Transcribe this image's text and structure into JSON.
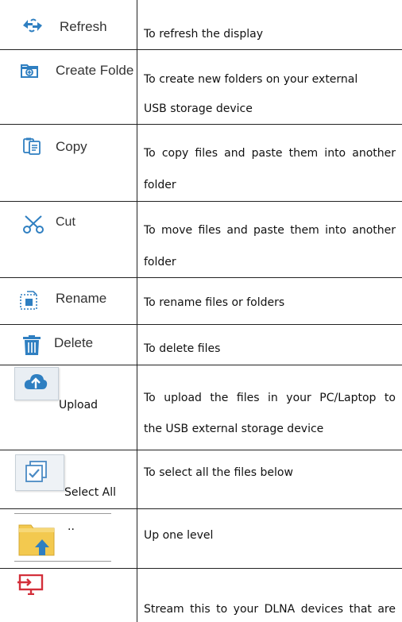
{
  "rows": [
    {
      "label": "Refresh",
      "icon": "refresh-icon",
      "desc": [
        "To refresh the display"
      ]
    },
    {
      "label": "Create Folde",
      "icon": "create-folder-icon",
      "desc": [
        "To create new folders on your external",
        "USB storage device"
      ]
    },
    {
      "label": "Copy",
      "icon": "copy-icon",
      "desc": [
        "To copy files and paste them into another",
        "folder"
      ]
    },
    {
      "label": "Cut",
      "icon": "scissors-icon",
      "desc": [
        "To move files and paste them into another",
        "folder"
      ]
    },
    {
      "label": "Rename",
      "icon": "rename-icon",
      "desc": [
        "To rename files or folders"
      ]
    },
    {
      "label": "Delete",
      "icon": "trash-icon",
      "desc": [
        "To delete files"
      ]
    },
    {
      "label": "Upload",
      "icon": "cloud-upload-icon",
      "desc": [
        "To upload the files in your PC/Laptop to",
        "the USB external storage device"
      ]
    },
    {
      "label": "Select All",
      "icon": "select-all-icon",
      "desc": [
        "To select all the files below"
      ]
    },
    {
      "label": "..",
      "icon": "folder-up-icon",
      "desc": [
        "Up one level"
      ]
    },
    {
      "label": "",
      "icon": "dlna-stream-icon",
      "desc": [
        "Stream this to your DLNA devices that are"
      ]
    }
  ],
  "colors": {
    "icon_blue": "#2f7fc1",
    "icon_red": "#d32f3a",
    "folder_yellow": "#f3c94f"
  }
}
